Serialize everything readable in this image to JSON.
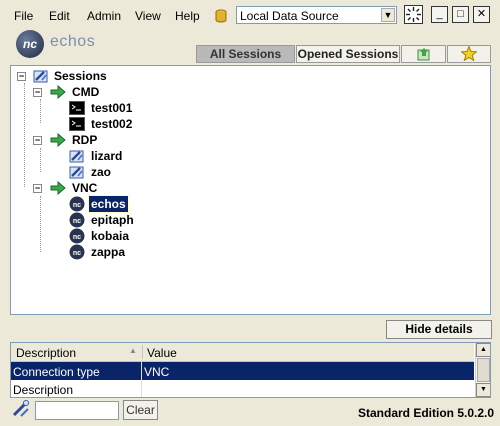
{
  "menu": {
    "file": "File",
    "edit": "Edit",
    "admin": "Admin",
    "view": "View",
    "help": "Help"
  },
  "data_source": {
    "selected": "Local Data Source",
    "icon": "database-cylinder-icon"
  },
  "app": {
    "logo_text": "nc",
    "name": "echos"
  },
  "tabs": {
    "all_sessions": "All Sessions",
    "opened_sessions": "Opened Sessions"
  },
  "tree": {
    "root": "Sessions",
    "groups": [
      {
        "label": "CMD",
        "items": [
          "test001",
          "test002"
        ]
      },
      {
        "label": "RDP",
        "items": [
          "lizard",
          "zao"
        ]
      },
      {
        "label": "VNC",
        "items": [
          "echos",
          "epitaph",
          "kobaia",
          "zappa"
        ]
      }
    ],
    "selected": "echos"
  },
  "details_toggle": "Hide details",
  "details": {
    "headers": [
      "Description",
      "Value"
    ],
    "rows": [
      {
        "name": "Connection type",
        "value": "VNC",
        "selected": true
      },
      {
        "name": "Description",
        "value": "",
        "selected": false
      }
    ]
  },
  "search": {
    "value": "",
    "clear_label": "Clear"
  },
  "edition": "Standard Edition 5.0.2.0",
  "colors": {
    "selection": "#0a246a",
    "window_bg": "#ece9d8",
    "group_arrow": "#3aa84a"
  }
}
